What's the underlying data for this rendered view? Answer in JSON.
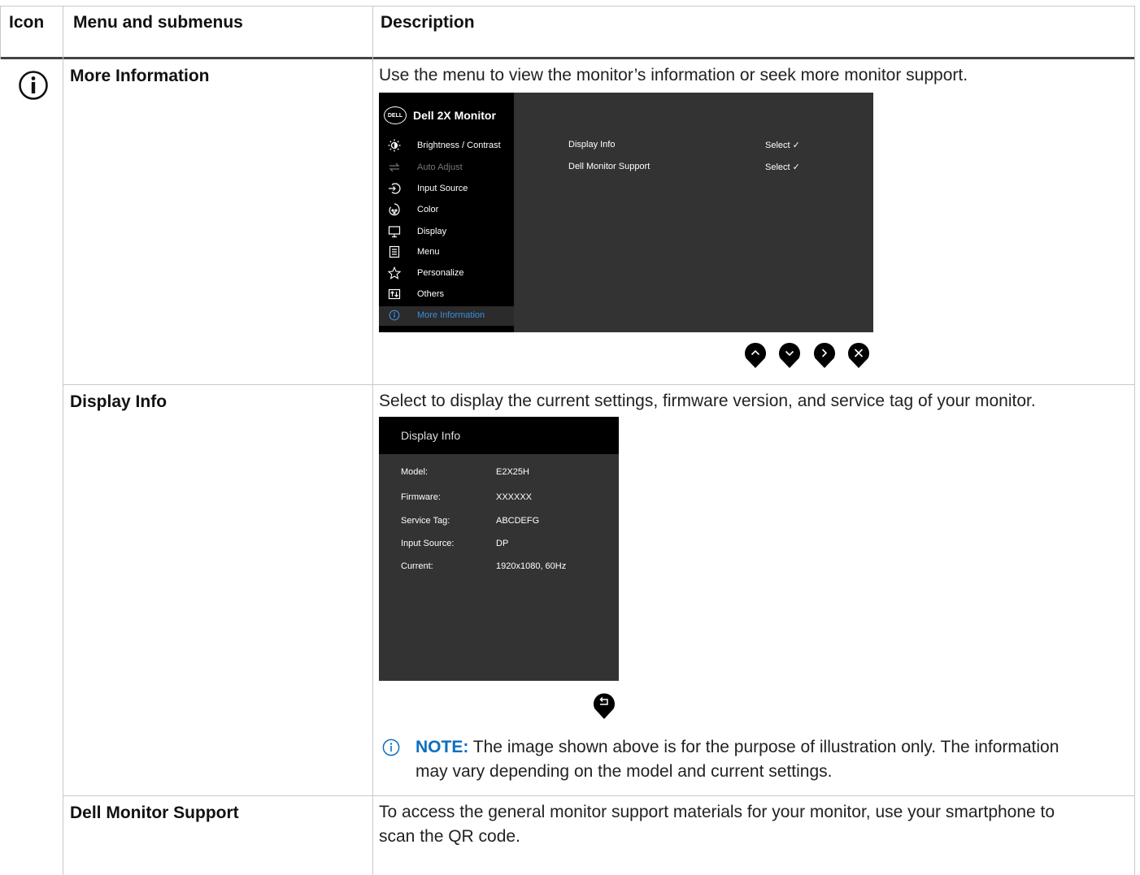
{
  "table": {
    "headers": {
      "icon": "Icon",
      "menu": "Menu and submenus",
      "description": "Description"
    }
  },
  "rows": {
    "more_info": {
      "name": "More Information",
      "description": "Use the menu to view the monitor’s information or seek more monitor support."
    },
    "display_info": {
      "name": "Display Info",
      "description": "Select to display the current settings, firmware version, and service tag of your monitor.",
      "note_label": "NOTE:",
      "note_line1": "The image shown above is for the purpose of illustration only. The information",
      "note_line2": "may vary depending on the model and current settings."
    },
    "support": {
      "name": "Dell Monitor Support",
      "description_line1": "To access the general monitor support materials for your monitor, use your smartphone to",
      "description_line2": "scan the QR code."
    }
  },
  "osd_menu": {
    "logo": "DELL",
    "title": "Dell 2X Monitor",
    "items": [
      {
        "label": "Brightness / Contrast",
        "icon": "brightness-icon"
      },
      {
        "label": "Auto Adjust",
        "icon": "auto-adjust-icon"
      },
      {
        "label": "Input Source",
        "icon": "input-source-icon"
      },
      {
        "label": "Color",
        "icon": "color-icon"
      },
      {
        "label": "Display",
        "icon": "display-icon"
      },
      {
        "label": "Menu",
        "icon": "menu-icon"
      },
      {
        "label": "Personalize",
        "icon": "star-icon"
      },
      {
        "label": "Others",
        "icon": "others-icon"
      },
      {
        "label": "More Information",
        "icon": "info-icon"
      }
    ],
    "options": [
      {
        "label": "Display Info",
        "value": "Select ✓"
      },
      {
        "label": "Dell Monitor Support",
        "value": "Select ✓"
      }
    ],
    "nav_buttons": [
      "up-icon",
      "down-icon",
      "right-icon",
      "close-icon"
    ]
  },
  "display_info_panel": {
    "title": "Display Info",
    "rows": [
      {
        "label": "Model:",
        "value": "E2X25H"
      },
      {
        "label": "Firmware:",
        "value": "XXXXXX"
      },
      {
        "label": "Service Tag:",
        "value": "ABCDEFG"
      },
      {
        "label": "Input Source:",
        "value": "DP"
      },
      {
        "label": "Current:",
        "value": "1920x1080, 60Hz"
      }
    ],
    "back_button": "back-icon"
  },
  "colors": {
    "note_accent": "#0b6fc0",
    "osd_highlight": "#3a8fe0",
    "osd_bg": "#333333"
  }
}
